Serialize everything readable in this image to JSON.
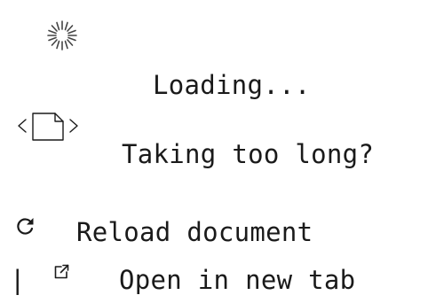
{
  "status": {
    "loading_text": "Loading...",
    "slow_text": "Taking too long?",
    "spinner_icon": "spinner-icon",
    "document_icon": "document-code-icon"
  },
  "actions": {
    "reload_label": "Reload document",
    "reload_icon": "reload-icon",
    "open_label": "Open in new tab",
    "open_icon": "external-link-icon"
  },
  "text_cursor": "|",
  "colors": {
    "text": "#1a1a1a",
    "icon": "#1a1a1a",
    "background": "#ffffff"
  }
}
